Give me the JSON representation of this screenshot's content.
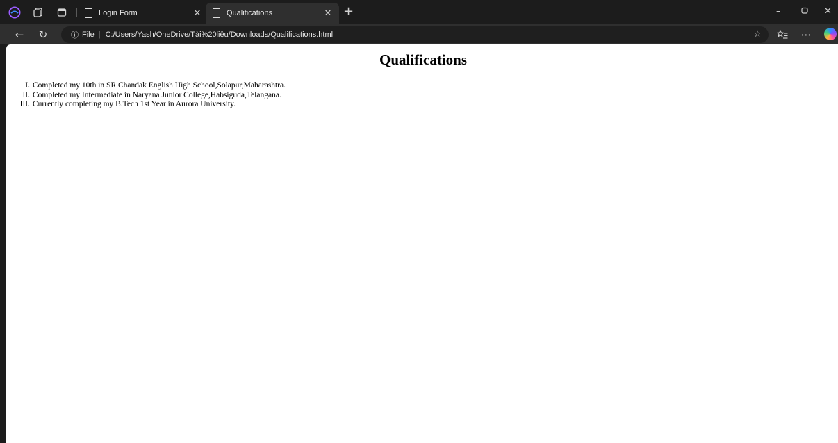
{
  "browser": {
    "tabs": [
      {
        "label": "Login Form",
        "active": false
      },
      {
        "label": "Qualifications",
        "active": true
      }
    ],
    "address_bar": {
      "protocol_label": "File",
      "url": "C:/Users/Yash/OneDrive/Tài%20liệu/Downloads/Qualifications.html"
    },
    "icons": {
      "profile": "profile-icon",
      "collections": "collections-icon",
      "tab_actions": "tab-actions-icon",
      "back": "back-arrow-icon",
      "refresh": "refresh-icon",
      "info": "info-icon",
      "favorite": "star-icon",
      "favorites_list": "favorites-icon",
      "more": "more-icon",
      "copilot": "copilot-icon"
    },
    "accent_colors": {
      "chrome_bg": "#1c1c1c",
      "active_tab_bg": "#2f2f2f",
      "page_bg": "#ffffff"
    }
  },
  "page": {
    "title": "Qualifications",
    "items": [
      {
        "marker": "I.",
        "text": "Completed my 10th in SR.Chandak English High School,Solapur,Maharashtra."
      },
      {
        "marker": "II.",
        "text": "Completed my Intermediate in Naryana Junior College,Habsiguda,Telangana."
      },
      {
        "marker": "III.",
        "text": "Currently completing my B.Tech 1st Year in Aurora University."
      }
    ]
  }
}
